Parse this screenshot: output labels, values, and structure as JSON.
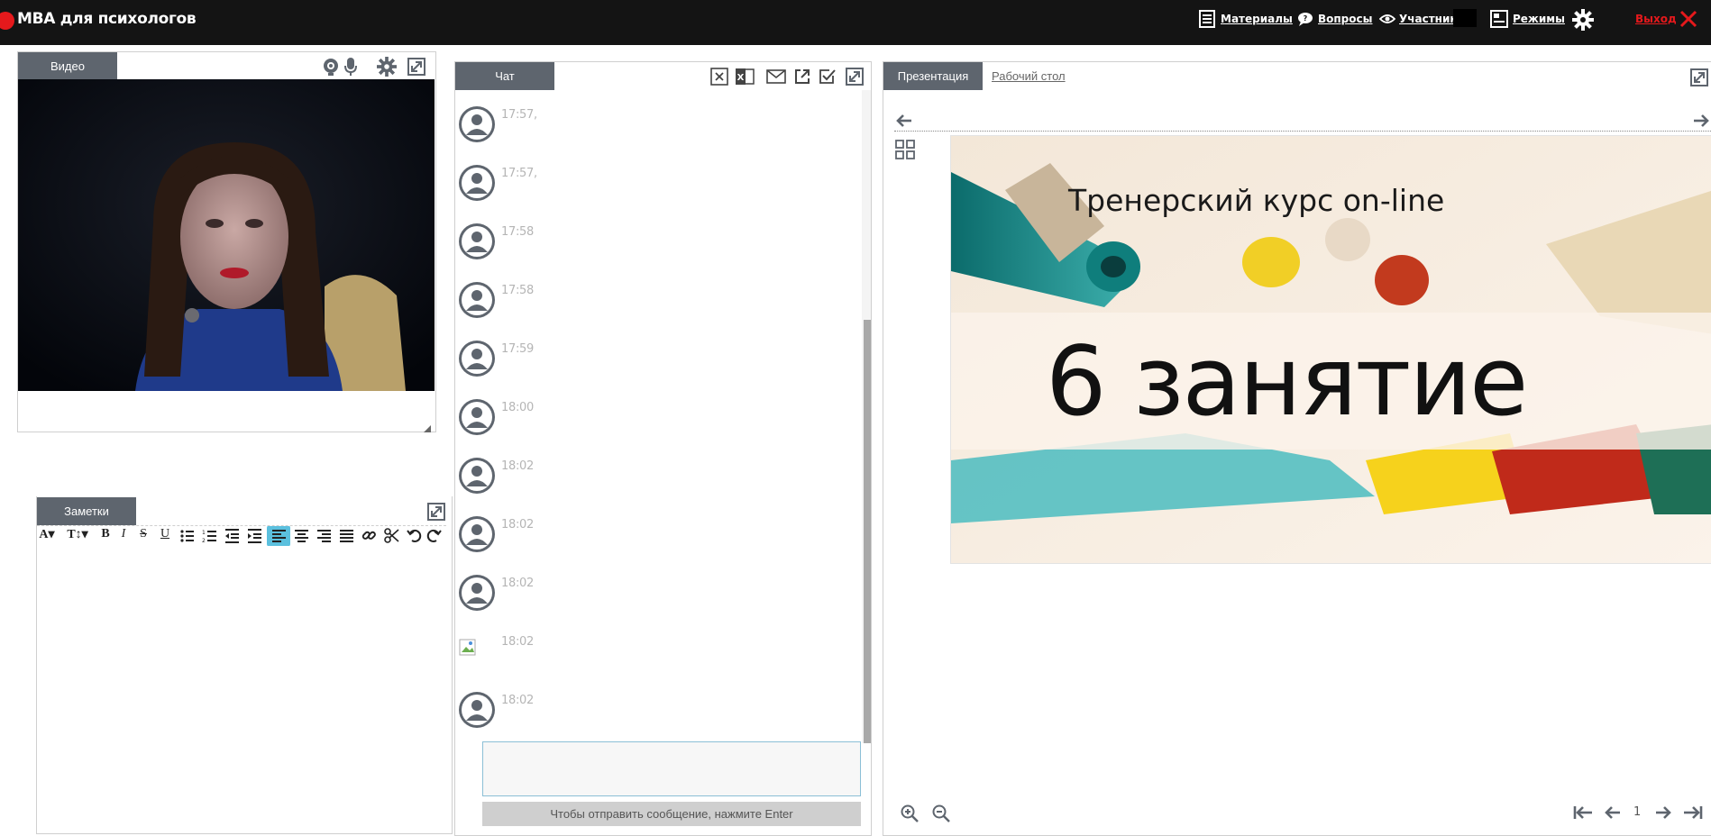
{
  "app": {
    "title": "MBA для психологов"
  },
  "topbar": {
    "materials": "Материалы",
    "questions": "Вопросы",
    "participants": "Участники",
    "modes": "Режимы",
    "exit": "Выход"
  },
  "video": {
    "tab_label": "Видео"
  },
  "notes": {
    "tab_label": "Заметки",
    "toolbar": [
      "A▾",
      "T↕▾",
      "B",
      "I",
      "S",
      "U"
    ]
  },
  "chat": {
    "tab_label": "Чат",
    "messages": [
      {
        "time": "17:57,"
      },
      {
        "time": "17:57,"
      },
      {
        "time": "17:58"
      },
      {
        "time": "17:58"
      },
      {
        "time": "17:59"
      },
      {
        "time": "18:00"
      },
      {
        "time": "18:02"
      },
      {
        "time": "18:02"
      },
      {
        "time": "18:02"
      },
      {
        "time": "18:02"
      },
      {
        "time": "18:02"
      }
    ],
    "input_value": "",
    "send_hint": "Чтобы отправить сообщение, нажмите Enter"
  },
  "presentation": {
    "tab_presentation": "Презентация",
    "tab_desktop": "Рабочий стол",
    "slide_subtitle": "Тренерский курс on-line",
    "slide_title": "6 занятие",
    "page_number": "1"
  },
  "colors": {
    "topbar_bg": "#141414",
    "tab_bg": "#5e656e",
    "accent_red": "#e5191c",
    "highlight_blue": "#5bc0de"
  }
}
